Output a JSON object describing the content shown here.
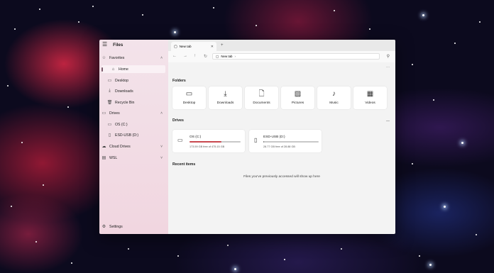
{
  "sidebar": {
    "app_title": "Files",
    "items": [
      {
        "label": "Favorites",
        "icon": "star-icon",
        "expandable": true
      },
      {
        "label": "Home",
        "icon": "home-icon",
        "selected": true
      },
      {
        "label": "Desktop",
        "icon": "desktop-icon"
      },
      {
        "label": "Downloads",
        "icon": "download-icon"
      },
      {
        "label": "Recycle Bin",
        "icon": "recycle-bin-icon"
      },
      {
        "label": "Drives",
        "icon": "drive-icon",
        "expandable": true
      },
      {
        "label": "OS (C:)",
        "icon": "drive-icon"
      },
      {
        "label": "ESD-USB (D:)",
        "icon": "usb-icon"
      },
      {
        "label": "Cloud Drives",
        "icon": "cloud-icon",
        "expandable": true
      },
      {
        "label": "WSL",
        "icon": "linux-icon",
        "expandable": true
      }
    ],
    "settings_label": "Settings"
  },
  "tab": {
    "label": "New tab"
  },
  "address": {
    "segment": "New tab",
    "chevron": "›"
  },
  "sections": {
    "folders": "Folders",
    "drives": "Drives",
    "recent": "Recent items"
  },
  "folders": [
    {
      "label": "Desktop",
      "icon": "desktop-icon"
    },
    {
      "label": "Downloads",
      "icon": "download-icon"
    },
    {
      "label": "Documents",
      "icon": "document-icon"
    },
    {
      "label": "Pictures",
      "icon": "picture-icon"
    },
    {
      "label": "Music",
      "icon": "music-icon"
    },
    {
      "label": "Videos",
      "icon": "video-icon"
    }
  ],
  "drives": [
    {
      "name": "OS (C:)",
      "free": "173.59 GB free of 475.15 GB",
      "used_fraction": 0.63,
      "bar_color": "#c8484f"
    },
    {
      "name": "ESD-USB (D:)",
      "free": "28.77 GB free of 28.88 GB",
      "used_fraction": 0.004,
      "bar_color": "#7a7a7a"
    }
  ],
  "recent_empty": "Files you've previously accessed will show up here",
  "colors": {
    "accent": "#c8484f",
    "sidebar_bg": "#f1d6e0"
  }
}
